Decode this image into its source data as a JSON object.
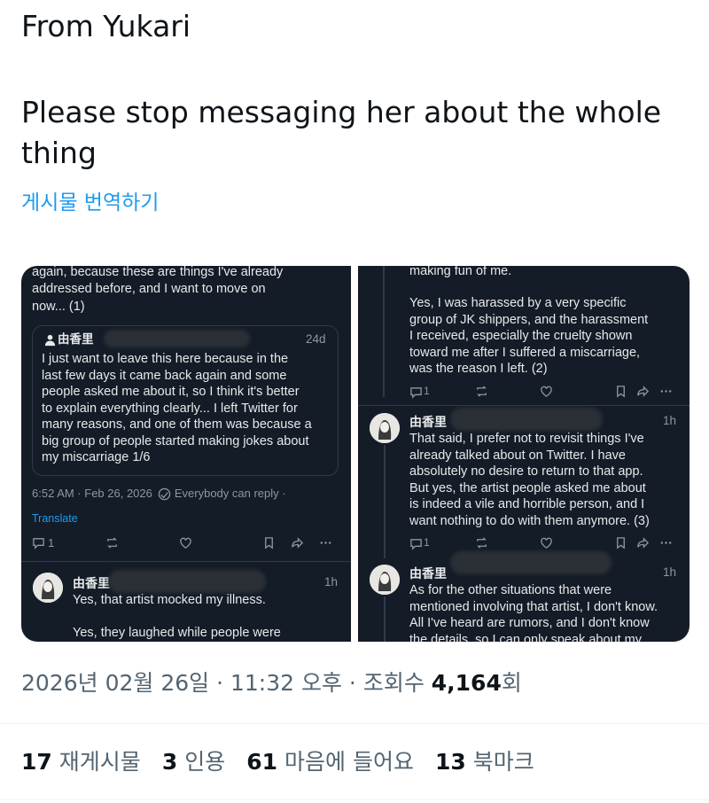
{
  "post": {
    "header_line": "From Yukari",
    "message": "Please stop messaging her about the whole thing",
    "translate_link": "게시물 번역하기"
  },
  "left_screenshot": {
    "top_text": [
      "again, because these are things I've already",
      "addressed before, and I want to move on",
      "now... (1)"
    ],
    "quote": {
      "author": "由香里",
      "age": "24d",
      "lines": [
        "I just want to leave this here because in the",
        "last few days it came back again and some",
        "people asked me about it, so I think it's better",
        "to explain everything clearly... I left Twitter for",
        "many reasons, and one of them was because a",
        "big group of people started making jokes about",
        "my miscarriage 1/6"
      ]
    },
    "timestamp": "6:52 AM · Feb 26, 2026",
    "reply_setting": "Everybody can reply ·",
    "translate": "Translate",
    "reply_count": "1",
    "reply": {
      "author": "由香里",
      "age": "1h",
      "lines": [
        "Yes, that artist mocked my illness.",
        "",
        "Yes, they laughed while people were"
      ]
    }
  },
  "right_screenshot": {
    "top_text": [
      "making fun of me."
    ],
    "para1": [
      "Yes, I was harassed by a very specific",
      "group of JK shippers, and the harassment",
      "I received, especially the cruelty shown",
      "toward me after I suffered a miscarriage,",
      "was the reason I left. (2)"
    ],
    "reply_count_1": "1",
    "post2": {
      "author": "由香里",
      "age": "1h",
      "lines": [
        "That said, I prefer not to revisit things I've",
        "already talked about on Twitter. I have",
        "absolutely no desire to return to that app.",
        "But yes, the artist people asked me about",
        "is indeed a vile and horrible person, and I",
        "want nothing to do with them anymore. (3)"
      ]
    },
    "reply_count_2": "1",
    "post3": {
      "author": "由香里",
      "age": "1h",
      "lines": [
        "As for the other situations that were",
        "mentioned involving that artist, I don't know.",
        "All I've heard are rumors, and I don't know",
        "the details, so I can only speak about my"
      ]
    }
  },
  "meta": {
    "datetime": "2026년 02월 26일 · 11:32 오후 · 조회수 ",
    "views": "4,164",
    "views_suffix": "회"
  },
  "stats": [
    {
      "count": "17",
      "label": "재게시물"
    },
    {
      "count": "3",
      "label": "인용"
    },
    {
      "count": "61",
      "label": "마음에 들어요"
    },
    {
      "count": "13",
      "label": "북마크"
    }
  ],
  "colors": {
    "link": "#1d9bf0",
    "dark_bg": "#141c27",
    "muted": "#536471"
  },
  "icons": [
    "reply-icon",
    "repost-icon",
    "like-icon",
    "bookmark-icon",
    "share-icon",
    "more-icon",
    "globe-icon",
    "user-icon"
  ]
}
